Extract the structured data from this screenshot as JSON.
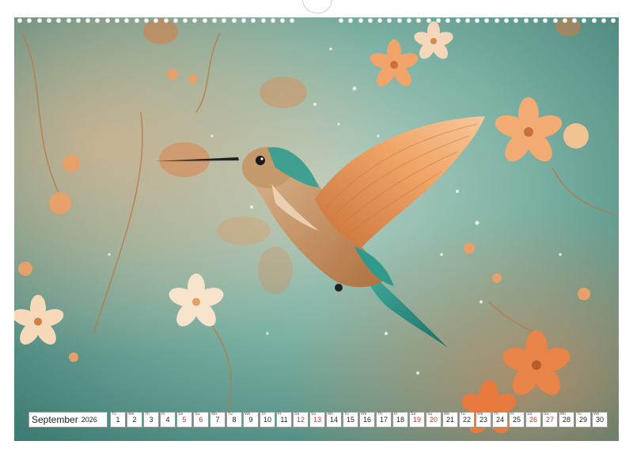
{
  "calendar": {
    "month": "September",
    "year": "2026",
    "weekday_letters": [
      "Tu",
      "We",
      "Th",
      "Fr",
      "Sa",
      "Su",
      "Mo"
    ],
    "days": [
      {
        "n": "1",
        "w": "Tu",
        "weekend": false
      },
      {
        "n": "2",
        "w": "We",
        "weekend": false
      },
      {
        "n": "3",
        "w": "Th",
        "weekend": false
      },
      {
        "n": "4",
        "w": "Fr",
        "weekend": false
      },
      {
        "n": "5",
        "w": "Sa",
        "weekend": true
      },
      {
        "n": "6",
        "w": "Su",
        "weekend": true
      },
      {
        "n": "7",
        "w": "Mo",
        "weekend": false
      },
      {
        "n": "8",
        "w": "Tu",
        "weekend": false
      },
      {
        "n": "9",
        "w": "We",
        "weekend": false
      },
      {
        "n": "10",
        "w": "Th",
        "weekend": false
      },
      {
        "n": "11",
        "w": "Fr",
        "weekend": false
      },
      {
        "n": "12",
        "w": "Sa",
        "weekend": true
      },
      {
        "n": "13",
        "w": "Su",
        "weekend": true
      },
      {
        "n": "14",
        "w": "Mo",
        "weekend": false
      },
      {
        "n": "15",
        "w": "Tu",
        "weekend": false
      },
      {
        "n": "16",
        "w": "We",
        "weekend": false
      },
      {
        "n": "17",
        "w": "Th",
        "weekend": false
      },
      {
        "n": "18",
        "w": "Fr",
        "weekend": false
      },
      {
        "n": "19",
        "w": "Sa",
        "weekend": true
      },
      {
        "n": "20",
        "w": "Su",
        "weekend": true
      },
      {
        "n": "21",
        "w": "Mo",
        "weekend": false
      },
      {
        "n": "22",
        "w": "Tu",
        "weekend": false
      },
      {
        "n": "23",
        "w": "We",
        "weekend": false
      },
      {
        "n": "24",
        "w": "Th",
        "weekend": false
      },
      {
        "n": "25",
        "w": "Fr",
        "weekend": false
      },
      {
        "n": "26",
        "w": "Sa",
        "weekend": true
      },
      {
        "n": "27",
        "w": "Su",
        "weekend": true
      },
      {
        "n": "28",
        "w": "Mo",
        "weekend": false
      },
      {
        "n": "29",
        "w": "Tu",
        "weekend": false
      },
      {
        "n": "30",
        "w": "We",
        "weekend": false
      }
    ]
  },
  "colors": {
    "background_teal": "#5f9e93",
    "wing_orange": "#e8a060",
    "flower_peach": "#f2b98a",
    "weekend_red": "#c0392b"
  }
}
